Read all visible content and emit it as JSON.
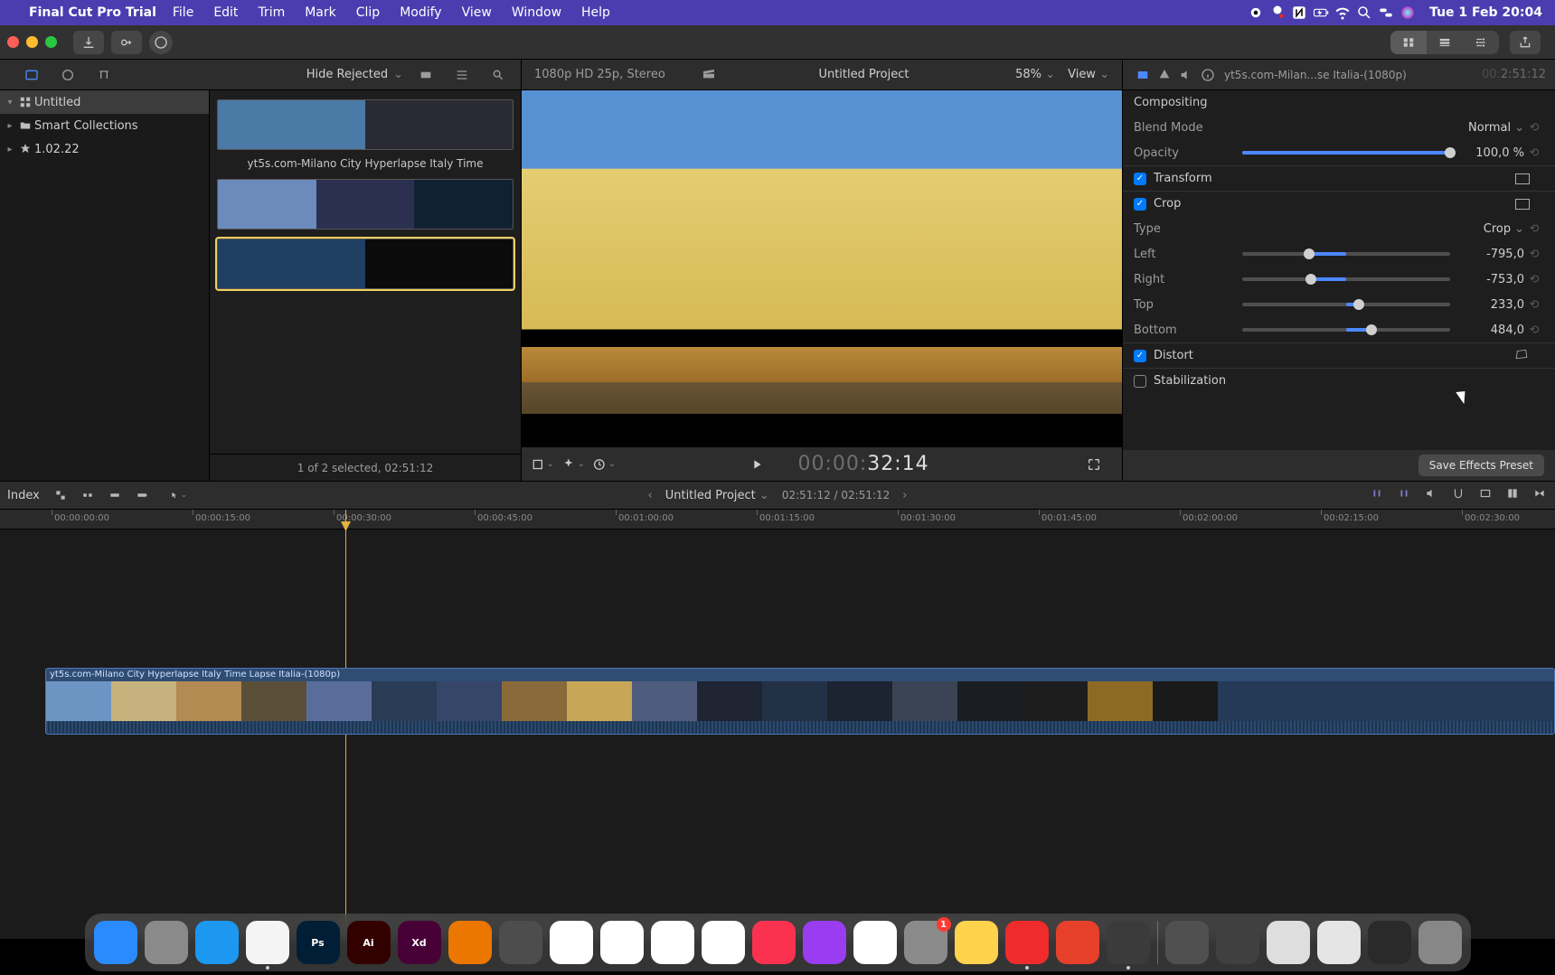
{
  "menubar": {
    "app_name": "Final Cut Pro Trial",
    "menus": [
      "File",
      "Edit",
      "Trim",
      "Mark",
      "Clip",
      "Modify",
      "View",
      "Window",
      "Help"
    ],
    "datetime": "Tue 1 Feb  20:04"
  },
  "browser_header": {
    "filter_label": "Hide Rejected"
  },
  "viewer_header": {
    "format": "1080p HD 25p, Stereo",
    "project_name": "Untitled Project",
    "zoom": "58%",
    "view_label": "View"
  },
  "inspector_header": {
    "clip_title": "yt5s.com-Milan...se Italia-(1080p)",
    "tc_dim_prefix": "00:",
    "tc": "2:51:12"
  },
  "sidebar": {
    "items": [
      {
        "label": "Untitled",
        "icon": "grid",
        "selected": true,
        "expandable": true
      },
      {
        "label": "Smart Collections",
        "icon": "folder",
        "selected": false,
        "expandable": true
      },
      {
        "label": "1.02.22",
        "icon": "clapper",
        "selected": false,
        "expandable": true
      }
    ]
  },
  "media": {
    "clips": [
      {
        "label": "yt5s.com-Milano City Hyperlapse Italy Time",
        "colors": [
          "#4c7aa6",
          "#2a2a34"
        ],
        "selected": false
      },
      {
        "label": "",
        "colors": [
          "#6a8bbb",
          "#2b3050",
          "#102133"
        ],
        "selected": false
      },
      {
        "label": "",
        "colors": [
          "#1f3f63",
          "#0b0b0b"
        ],
        "selected": true
      }
    ],
    "footer": "1 of 2 selected, 02:51:12"
  },
  "viewer_footer": {
    "tc_dim": "00:00:",
    "tc_bright": "32:14"
  },
  "inspector": {
    "compositing_title": "Compositing",
    "blend_mode_label": "Blend Mode",
    "blend_mode_value": "Normal",
    "opacity_label": "Opacity",
    "opacity_value": "100,0",
    "opacity_unit": "%",
    "transform_label": "Transform",
    "crop_label": "Crop",
    "type_label": "Type",
    "type_value": "Crop",
    "params": [
      {
        "label": "Left",
        "value": "-795,0",
        "knob": 32,
        "fill_l": 32,
        "fill_r": 50
      },
      {
        "label": "Right",
        "value": "-753,0",
        "knob": 33,
        "fill_l": 33,
        "fill_r": 50
      },
      {
        "label": "Top",
        "value": "233,0",
        "knob": 56,
        "fill_l": 50,
        "fill_r": 56
      },
      {
        "label": "Bottom",
        "value": "484,0",
        "knob": 62,
        "fill_l": 50,
        "fill_r": 62
      }
    ],
    "distort_label": "Distort",
    "stabilization_label": "Stabilization",
    "save_preset_btn": "Save Effects Preset"
  },
  "timeline": {
    "index_label": "Index",
    "project": "Untitled Project",
    "tc_pair": "02:51:12 / 02:51:12",
    "clip_title": "yt5s.com-Milano City Hyperlapse Italy Time Lapse Italia-(1080p)",
    "ruler": [
      "00:00:00:00",
      "00:00:15:00",
      "00:00:30:00",
      "00:00:45:00",
      "00:01:00:00",
      "00:01:15:00",
      "00:01:30:00",
      "00:01:45:00",
      "00:02:00:00",
      "00:02:15:00",
      "00:02:30:00"
    ],
    "clip_colors": [
      "#6d95c4",
      "#c6b27c",
      "#b38a52",
      "#5b4f3a",
      "#5a6d9a",
      "#2a3c56",
      "#354668",
      "#8a6a3a",
      "#c7a658",
      "#505c7e",
      "#1f2433",
      "#233147",
      "#1c2331",
      "#3a4454",
      "#1a1d24",
      "#1d1d1d",
      "#8c6a26",
      "#1a1a1a"
    ]
  },
  "dock": {
    "apps": [
      {
        "name": "Finder",
        "bg": "#2a8bff"
      },
      {
        "name": "Launchpad",
        "bg": "#8a8a8a"
      },
      {
        "name": "Safari",
        "bg": "#1c98f0"
      },
      {
        "name": "Chrome",
        "bg": "#f4f4f4",
        "running": true
      },
      {
        "name": "Ps",
        "bg": "#001e36",
        "label": "Ps"
      },
      {
        "name": "Ai",
        "bg": "#330000",
        "label": "Ai"
      },
      {
        "name": "Xd",
        "bg": "#470137",
        "label": "Xd"
      },
      {
        "name": "Blender",
        "bg": "#eb7700"
      },
      {
        "name": "Krita",
        "bg": "#4d4d4d"
      },
      {
        "name": "Messenger",
        "bg": "#ffffff"
      },
      {
        "name": "Mail",
        "bg": "#ffffff"
      },
      {
        "name": "Maps",
        "bg": "#ffffff"
      },
      {
        "name": "Photos",
        "bg": "#ffffff"
      },
      {
        "name": "Music",
        "bg": "#fa3250"
      },
      {
        "name": "Podcasts",
        "bg": "#9a3cf0"
      },
      {
        "name": "Numbers",
        "bg": "#ffffff"
      },
      {
        "name": "Settings",
        "bg": "#8a8a8a",
        "badge": "1"
      },
      {
        "name": "Notes",
        "bg": "#ffd24d"
      },
      {
        "name": "AnyDesk",
        "bg": "#ef2b2b",
        "running": true
      },
      {
        "name": "Todoist",
        "bg": "#e6402b"
      },
      {
        "name": "FinalCut",
        "bg": "#3b3b3b",
        "running": true
      }
    ],
    "right": [
      {
        "name": "Doc1",
        "bg": "#505050"
      },
      {
        "name": "Doc2",
        "bg": "#404040"
      },
      {
        "name": "Doc3",
        "bg": "#dedede"
      },
      {
        "name": "Doc4",
        "bg": "#e5e5e5"
      },
      {
        "name": "Doc5",
        "bg": "#2a2a2a"
      },
      {
        "name": "Trash",
        "bg": "#878787"
      }
    ]
  }
}
